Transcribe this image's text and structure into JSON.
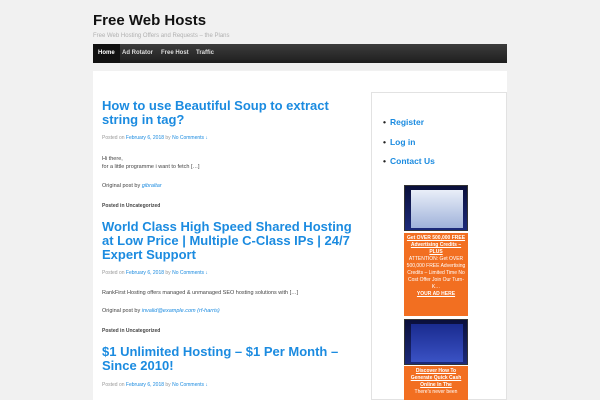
{
  "site": {
    "title": "Free Web Hosts",
    "tagline": "Free Web Hosting Offers and Requests – the Plans"
  },
  "nav": {
    "items": [
      {
        "label": "Home"
      },
      {
        "label": "Ad Rotator"
      },
      {
        "label": "Free Host"
      },
      {
        "label": "Traffic"
      }
    ]
  },
  "posts": [
    {
      "title": "How to use Beautiful Soup to extract string in tag?",
      "meta_prefix": "Posted on",
      "date": "February 6, 2018",
      "by": "by",
      "comments": "No Comments ↓",
      "excerpt_line1": "Hi there,",
      "excerpt_line2": "for a little programme i want to fetch […]",
      "original_prefix": "Original post by",
      "original_author": "gibraltar",
      "posted_in": "Posted in Uncategorized"
    },
    {
      "title": "World Class High Speed Shared Hosting at Low Price | Multiple C-Class IPs | 24/7 Expert Support",
      "meta_prefix": "Posted on",
      "date": "February 6, 2018",
      "by": "by",
      "comments": "No Comments ↓",
      "excerpt_line1": "RankFirst Hosting offers managed & unmanaged SEO hosting solutions with […]",
      "original_prefix": "Original post by",
      "original_author": "invalid@example.com (rf-harris)",
      "posted_in": "Posted in Uncategorized"
    },
    {
      "title": "$1 Unlimited Hosting – $1 Per Month – Since 2010!",
      "meta_prefix": "Posted on",
      "date": "February 6, 2018",
      "by": "by",
      "comments": "No Comments ↓"
    }
  ],
  "sidebar": {
    "links": [
      {
        "label": "Register"
      },
      {
        "label": "Log in"
      },
      {
        "label": "Contact Us"
      }
    ],
    "ads": [
      {
        "head": "Get OVER 500,000 FREE Advertising Credits – PLUS",
        "body": "ATTENTION: Get OVER 500,000 FREE Advertising Credits – Limited Time No Cost Offer Join Our Turn-K…",
        "cta": "YOUR AD HERE"
      },
      {
        "head": "Discover How To Generate Quick Cash Online In The",
        "body": "There's never been"
      }
    ]
  }
}
